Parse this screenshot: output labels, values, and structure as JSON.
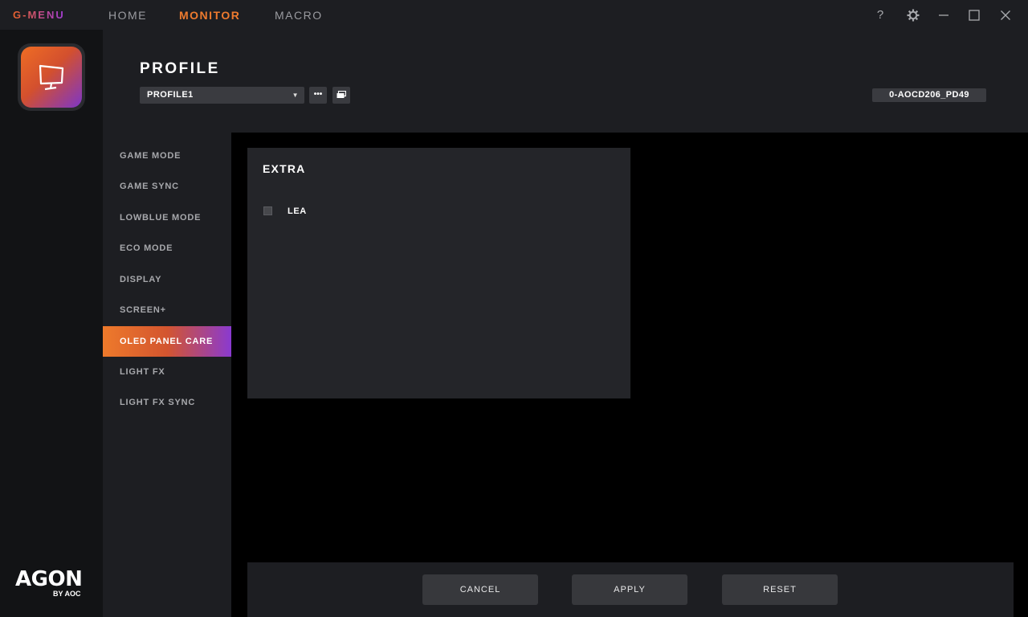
{
  "topbar": {
    "brand": "G-MENU",
    "nav": [
      "HOME",
      "MONITOR",
      "MACRO"
    ],
    "active_nav": "MONITOR",
    "icons": [
      "help-icon",
      "gear-icon",
      "minimize-icon",
      "maximize-icon",
      "close-icon"
    ]
  },
  "branding": {
    "logo_word": "AGON",
    "logo_sub": "BY AOC"
  },
  "profile": {
    "title": "PROFILE",
    "selected": "PROFILE1",
    "device": "0-AOCD206_PD49"
  },
  "sidebar": {
    "items": [
      {
        "label": "GAME MODE"
      },
      {
        "label": "GAME SYNC"
      },
      {
        "label": "LOWBLUE MODE"
      },
      {
        "label": "ECO MODE"
      },
      {
        "label": "DISPLAY"
      },
      {
        "label": "SCREEN+"
      },
      {
        "label": "OLED PANEL CARE"
      },
      {
        "label": "LIGHT FX"
      },
      {
        "label": "LIGHT FX SYNC"
      }
    ],
    "active": "OLED PANEL CARE"
  },
  "panel": {
    "title": "EXTRA",
    "options": [
      {
        "label": "LEA",
        "checked": false
      }
    ]
  },
  "footer": {
    "cancel": "CANCEL",
    "apply": "APPLY",
    "reset": "RESET"
  },
  "colors": {
    "accent_orange": "#ee7a2e",
    "accent_purple": "#8a3ad0",
    "panel_bg": "#242529",
    "chrome_bg": "#1d1e22"
  }
}
